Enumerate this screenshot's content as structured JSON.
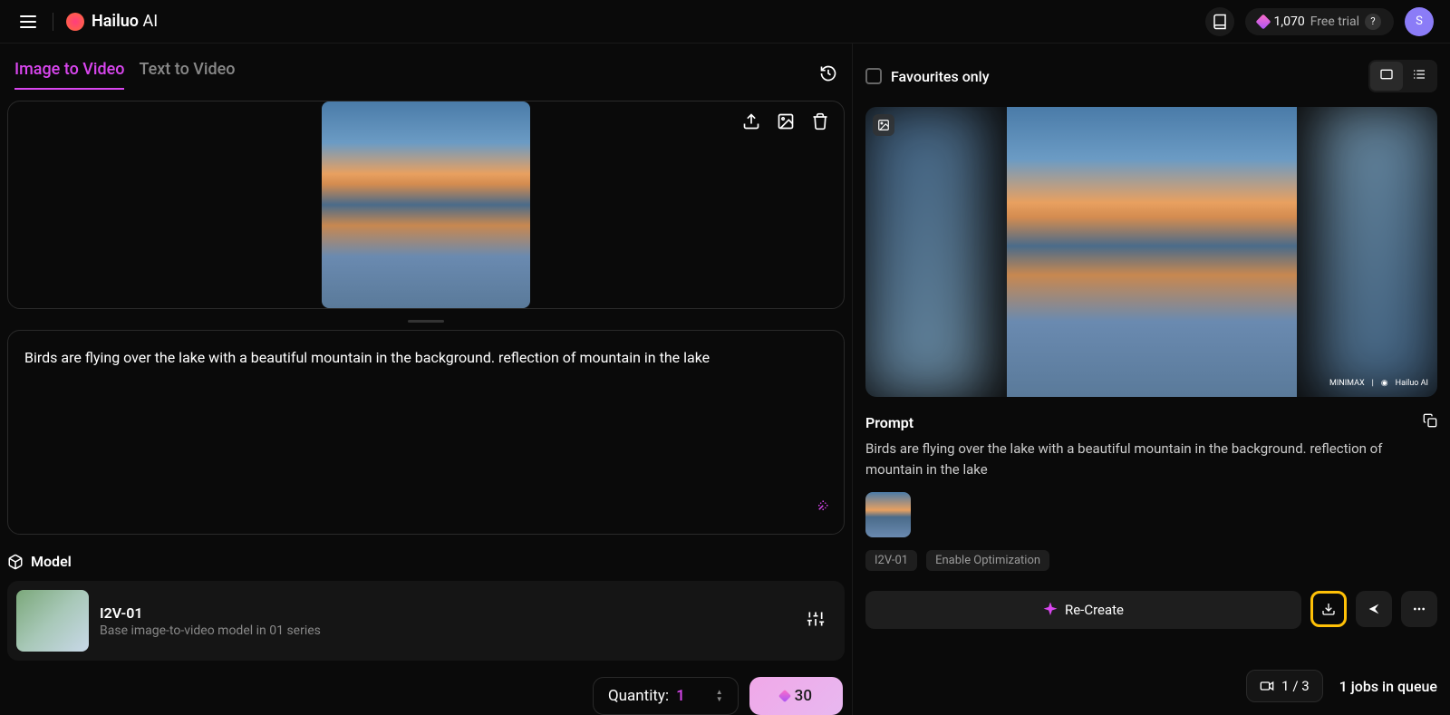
{
  "header": {
    "logo_name": "Hailuo",
    "logo_suffix": "AI",
    "credits": "1,070",
    "trial_label": "Free trial",
    "avatar_initial": "S"
  },
  "tabs": {
    "image_to_video": "Image to Video",
    "text_to_video": "Text to Video"
  },
  "prompt": {
    "text": "Birds are flying over the lake with a beautiful mountain in the background. reflection of mountain in the lake"
  },
  "model": {
    "section_label": "Model",
    "name": "I2V-01",
    "description": "Base image-to-video model in 01 series"
  },
  "controls": {
    "quantity_label": "Quantity:",
    "quantity_value": "1",
    "generate_cost": "30"
  },
  "right": {
    "favourites_label": "Favourites only",
    "prompt_title": "Prompt",
    "prompt_text": "Birds are flying over the lake with a beautiful mountain in the background. reflection of mountain in the lake",
    "badges": {
      "model": "I2V-01",
      "optimization": "Enable Optimization"
    },
    "recreate_label": "Re-Create",
    "watermark_minimax": "MINIMAX",
    "watermark_hailuo": "Hailuo AI"
  },
  "status": {
    "queue_current": "1",
    "queue_total": "3",
    "jobs_label": "1 jobs in queue"
  }
}
